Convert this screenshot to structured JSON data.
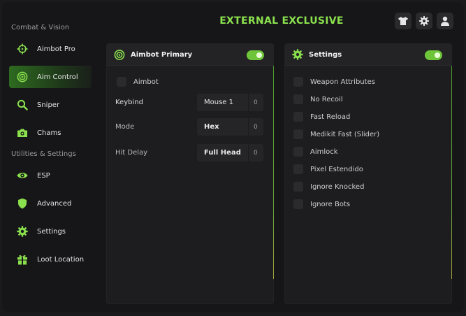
{
  "header": {
    "title": "EXTERNAL EXCLUSIVE"
  },
  "top_icons": [
    "shirt-icon",
    "gear-icon",
    "user-icon"
  ],
  "sidebar": {
    "sections": [
      {
        "title": "Combat & Vision",
        "items": [
          {
            "label": "Aimbot Pro",
            "icon": "crosshair-icon",
            "active": false
          },
          {
            "label": "Aim Control",
            "icon": "target-icon",
            "active": true
          },
          {
            "label": "Sniper",
            "icon": "search-icon",
            "active": false
          },
          {
            "label": "Chams",
            "icon": "camera-icon",
            "active": false
          }
        ]
      },
      {
        "title": "Utilities & Settings",
        "items": [
          {
            "label": "ESP",
            "icon": "eye-icon",
            "active": false
          },
          {
            "label": "Advanced",
            "icon": "shield-icon",
            "active": false
          },
          {
            "label": "Settings",
            "icon": "gear-icon",
            "active": false
          },
          {
            "label": "Loot Location",
            "icon": "gift-icon",
            "active": false
          }
        ]
      }
    ]
  },
  "panels": {
    "primary": {
      "title": "Aimbot Primary",
      "enabled": true,
      "checkbox_label": "Aimbot",
      "fields": [
        {
          "label": "Keybind",
          "value": "Mouse 1",
          "count": "0"
        },
        {
          "label": "Mode",
          "value": "Hex",
          "count": "0"
        },
        {
          "label": "Hit Delay",
          "value": "Full Head",
          "count": "0"
        }
      ]
    },
    "settings": {
      "title": "Settings",
      "enabled": true,
      "options": [
        "Weapon Attributes",
        "No Recoil",
        "Fast Reload",
        "Medikit Fast (Slider)",
        "Aimlock",
        "Pixel Estendido",
        "Ignore Knocked",
        "Ignore Bots"
      ]
    }
  },
  "colors": {
    "accent": "#8be04e",
    "toggle": "#6fc53a",
    "background": "#161618"
  }
}
